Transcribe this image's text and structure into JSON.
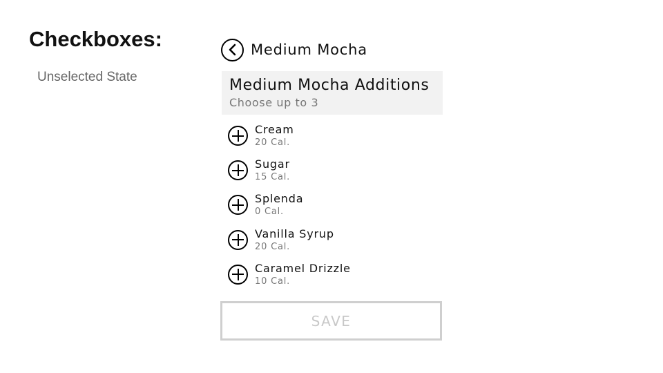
{
  "slide": {
    "title": "Checkboxes:",
    "subtitle": "Unselected State"
  },
  "nav": {
    "back_icon": "chevron-left-icon",
    "title": "Medium Mocha"
  },
  "header": {
    "title": "Medium Mocha Additions",
    "subtitle": "Choose up to 3"
  },
  "options": [
    {
      "name": "Cream",
      "calories": "20 Cal.",
      "icon": "plus-circle-icon",
      "selected": false
    },
    {
      "name": "Sugar",
      "calories": "15 Cal.",
      "icon": "plus-circle-icon",
      "selected": false
    },
    {
      "name": "Splenda",
      "calories": "0 Cal.",
      "icon": "plus-circle-icon",
      "selected": false
    },
    {
      "name": "Vanilla Syrup",
      "calories": "20 Cal.",
      "icon": "plus-circle-icon",
      "selected": false
    },
    {
      "name": "Caramel Drizzle",
      "calories": "10 Cal.",
      "icon": "plus-circle-icon",
      "selected": false
    }
  ],
  "save_button": {
    "label": "SAVE",
    "enabled": false
  },
  "colors": {
    "header_bg": "#f2f2f2",
    "disabled_text": "#c8c8c8",
    "disabled_border": "#cfcfcf",
    "secondary_text": "#777777"
  }
}
